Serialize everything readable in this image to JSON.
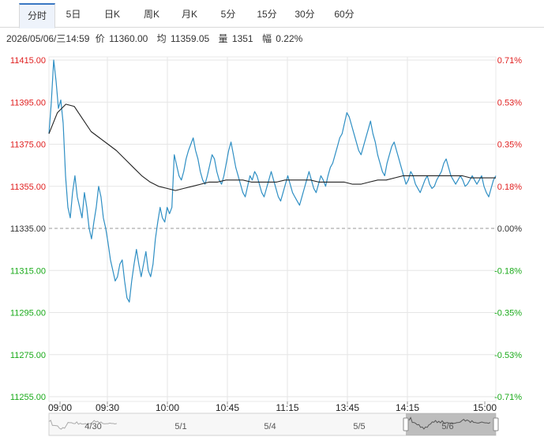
{
  "tabs": [
    {
      "label": "分时",
      "active": true
    },
    {
      "label": "5日",
      "active": false
    },
    {
      "label": "日K",
      "active": false
    },
    {
      "label": "周K",
      "active": false
    },
    {
      "label": "月K",
      "active": false
    },
    {
      "label": "5分",
      "active": false
    },
    {
      "label": "15分",
      "active": false
    },
    {
      "label": "30分",
      "active": false
    },
    {
      "label": "60分",
      "active": false
    }
  ],
  "info": {
    "datetime": "2026/05/06/三14:59",
    "price_label": "价",
    "price": "11360.00",
    "avg_label": "均",
    "avg": "11359.05",
    "volume_label": "量",
    "volume": "1351",
    "change_label": "幅",
    "change": "0.22%"
  },
  "colors": {
    "up": "#e02020",
    "down": "#1aaa1a",
    "neutral": "#333333",
    "price_line": "#2f8fc4",
    "avg_line": "#222222",
    "grid": "#e6e6e6",
    "baseline": "#999999"
  },
  "chart_data": {
    "type": "line",
    "title": "",
    "prev_close": 11335.0,
    "ylim": [
      11255.0,
      11415.0
    ],
    "y_ticks_left": [
      "11415.00",
      "11395.00",
      "11375.00",
      "11355.00",
      "11335.00",
      "11315.00",
      "11295.00",
      "11275.00",
      "11255.00"
    ],
    "y_ticks_right": [
      "0.71%",
      "0.53%",
      "0.35%",
      "0.18%",
      "0.00%",
      "-0.18%",
      "-0.35%",
      "-0.53%",
      "-0.71%"
    ],
    "x_ticks": [
      "09:00",
      "09:30",
      "10:00",
      "10:45",
      "11:15",
      "13:45",
      "14:15",
      "15:00"
    ],
    "grid": true,
    "series": [
      {
        "name": "",
        "role": "price",
        "values": [
          11380,
          11395,
          11415,
          11405,
          11392,
          11396,
          11385,
          11360,
          11345,
          11340,
          11352,
          11360,
          11350,
          11345,
          11340,
          11352,
          11345,
          11335,
          11330,
          11338,
          11345,
          11355,
          11350,
          11340,
          11335,
          11328,
          11320,
          11315,
          11310,
          11312,
          11318,
          11320,
          11310,
          11302,
          11300,
          11310,
          11318,
          11325,
          11318,
          11312,
          11318,
          11324,
          11315,
          11312,
          11318,
          11330,
          11338,
          11345,
          11340,
          11338,
          11345,
          11342,
          11345,
          11370,
          11365,
          11360,
          11358,
          11362,
          11368,
          11372,
          11375,
          11378,
          11372,
          11368,
          11362,
          11358,
          11356,
          11360,
          11365,
          11370,
          11368,
          11362,
          11358,
          11356,
          11360,
          11366,
          11372,
          11376,
          11370,
          11364,
          11360,
          11356,
          11352,
          11350,
          11355,
          11360,
          11358,
          11362,
          11360,
          11356,
          11352,
          11350,
          11354,
          11358,
          11362,
          11358,
          11354,
          11350,
          11348,
          11352,
          11356,
          11360,
          11356,
          11352,
          11350,
          11348,
          11346,
          11350,
          11354,
          11358,
          11362,
          11358,
          11354,
          11352,
          11356,
          11360,
          11358,
          11355,
          11360,
          11364,
          11366,
          11370,
          11374,
          11378,
          11380,
          11385,
          11390,
          11388,
          11384,
          11380,
          11376,
          11372,
          11370,
          11374,
          11378,
          11382,
          11386,
          11380,
          11376,
          11370,
          11366,
          11362,
          11360,
          11366,
          11370,
          11374,
          11376,
          11372,
          11368,
          11364,
          11360,
          11356,
          11358,
          11362,
          11360,
          11356,
          11354,
          11352,
          11355,
          11358,
          11360,
          11356,
          11354,
          11355,
          11358,
          11360,
          11362,
          11366,
          11368,
          11364,
          11360,
          11358,
          11356,
          11358,
          11360,
          11358,
          11355,
          11356,
          11358,
          11360,
          11358,
          11356,
          11358,
          11360,
          11355,
          11352,
          11350,
          11354,
          11358,
          11360
        ]
      },
      {
        "name": "",
        "role": "average",
        "values": [
          11380,
          11390,
          11394,
          11393,
          11387,
          11381,
          11378,
          11375,
          11372,
          11368,
          11364,
          11360,
          11357,
          11355,
          11354,
          11353,
          11354,
          11355,
          11356,
          11357,
          11357,
          11358,
          11358,
          11358,
          11357,
          11357,
          11357,
          11357,
          11358,
          11358,
          11358,
          11358,
          11357,
          11357,
          11357,
          11357,
          11356,
          11356,
          11357,
          11358,
          11358,
          11359,
          11360,
          11360,
          11360,
          11360,
          11360,
          11360,
          11360,
          11360,
          11359,
          11359,
          11359,
          11359
        ]
      }
    ]
  },
  "navigator": {
    "labels": [
      "4/30",
      "5/1",
      "5/4",
      "5/5",
      "5/6"
    ]
  }
}
